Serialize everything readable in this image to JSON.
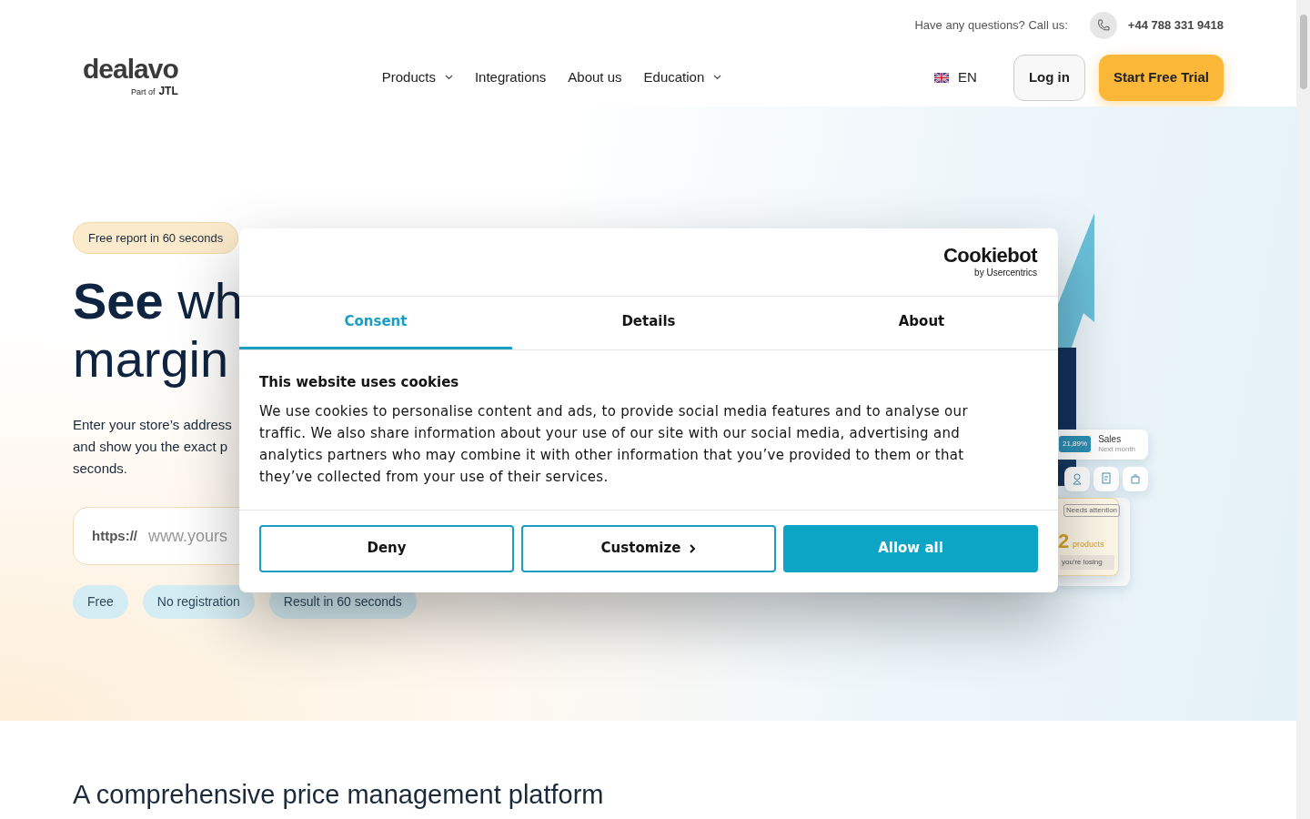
{
  "top_bar": {
    "question": "Have any questions? Call us:",
    "phone": "+44 788 331 9418"
  },
  "nav": {
    "logo": {
      "name": "dealavo",
      "sub": "Part of",
      "sub_brand": "JTL"
    },
    "items": [
      {
        "label": "Products",
        "dropdown": true
      },
      {
        "label": "Integrations",
        "dropdown": false
      },
      {
        "label": "About us",
        "dropdown": false
      },
      {
        "label": "Education",
        "dropdown": true
      }
    ],
    "language": "EN",
    "login": "Log in",
    "trial": "Start Free Trial"
  },
  "hero": {
    "badge": "Free report in 60 seconds",
    "heading_bold": "See",
    "heading_rest": "wh",
    "heading_line2": "margin",
    "description_lines": [
      "Enter your store’s address",
      "and show you the exact p",
      "seconds."
    ],
    "url_prefix": "https://",
    "url_placeholder": "www.yours",
    "tags": [
      "Free",
      "No registration",
      "Result in 60 seconds"
    ]
  },
  "dashboard": {
    "change": "21,89%",
    "sales": "Sales",
    "sales_sub": "Next month",
    "attention": "Needs attention",
    "count": "2",
    "count_label": "products",
    "losing": "you're losing"
  },
  "cookie_dialog": {
    "brand": "Cookiebot",
    "brand_sub": "by Usercentrics",
    "tabs": [
      {
        "label": "Consent",
        "selected": true
      },
      {
        "label": "Details",
        "selected": false
      },
      {
        "label": "About",
        "selected": false
      }
    ],
    "title": "This website uses cookies",
    "body": "We use cookies to personalise content and ads, to provide social media features and to analyse our traffic. We also share information about your use of our site with our social media, advertising and analytics partners who may combine it with other information that you’ve provided to them or that they’ve collected from your use of their services.",
    "buttons": [
      {
        "label": "Deny",
        "kind": "outline",
        "chevron": false
      },
      {
        "label": "Customize",
        "kind": "outline",
        "chevron": true
      },
      {
        "label": "Allow all",
        "kind": "primary",
        "chevron": false
      }
    ]
  },
  "section_heading": "A comprehensive price management platform"
}
